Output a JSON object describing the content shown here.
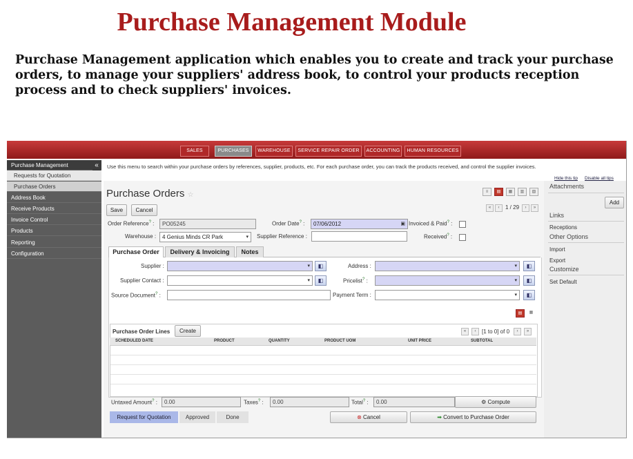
{
  "heading": "Purchase Management Module",
  "intro": "Purchase Management application which enables you to create and track your purchase orders, to manage your suppliers' address book, to control your products reception process and to check suppliers' invoices.",
  "top_menu": [
    "SALES",
    "PURCHASES",
    "WAREHOUSE",
    "SERVICE REPAIR ORDER",
    "ACCOUNTING",
    "HUMAN RESOURCES"
  ],
  "active_menu": "PURCHASES",
  "sidebar": {
    "header": "Purchase Management",
    "sub_items": [
      "Requests for Quotation",
      "Purchase Orders"
    ],
    "selected": "Purchase Orders",
    "items": [
      "Address Book",
      "Receive Products",
      "Invoice Control",
      "Products",
      "Reporting",
      "Configuration"
    ]
  },
  "help_text": "Use this menu to search within your purchase orders by references, supplier, products, etc. For each purchase order, you can track the products received, and control the supplier invoices.",
  "top_links": {
    "hide_tip": "Hide this tip",
    "disable_tips": "Disable all tips"
  },
  "page_title": "Purchase Orders",
  "pager_top": "1 / 29",
  "buttons": {
    "save": "Save",
    "cancel": "Cancel"
  },
  "form": {
    "order_ref_label": "Order Reference",
    "order_ref_value": "PO05245",
    "order_date_label": "Order Date",
    "order_date_value": "07/06/2012",
    "invoiced_paid_label": "Invoiced & Paid",
    "warehouse_label": "Warehouse",
    "warehouse_value": "4 Genius Minds CR Park",
    "supplier_ref_label": "Supplier Reference",
    "received_label": "Received"
  },
  "tabs": [
    "Purchase Order",
    "Delivery & Invoicing",
    "Notes"
  ],
  "po_tab": {
    "supplier_label": "Supplier",
    "supplier_contact_label": "Supplier Contact",
    "source_document_label": "Source Document",
    "address_label": "Address",
    "pricelist_label": "Pricelist",
    "payment_term_label": "Payment Term"
  },
  "lines": {
    "title": "Purchase Order Lines",
    "create": "Create",
    "pager": "[1 to 0] of 0",
    "columns": [
      "SCHEDULED DATE",
      "PRODUCT",
      "QUANTITY",
      "PRODUCT UOM",
      "UNIT PRICE",
      "SUBTOTAL"
    ]
  },
  "totals": {
    "untaxed_label": "Untaxed Amount",
    "untaxed_value": "0.00",
    "taxes_label": "Taxes",
    "taxes_value": "0.00",
    "total_label": "Total",
    "total_value": "0.00",
    "compute": "Compute"
  },
  "workflow": [
    "Request for Quotation",
    "Approved",
    "Done"
  ],
  "actions": {
    "cancel": "Cancel",
    "convert": "Convert to Purchase Order"
  },
  "right_panel": {
    "attachments": "Attachments",
    "add": "Add",
    "links": "Links",
    "receptions": "Receptions",
    "other_options": "Other Options",
    "import": "Import",
    "export": "Export",
    "customize": "Customize",
    "set_default": "Set Default"
  },
  "colors": {
    "title": "#a81c1c",
    "topbar": "#b02828",
    "sidebar": "#5c5c5c",
    "required_field": "#d6d6f5"
  }
}
